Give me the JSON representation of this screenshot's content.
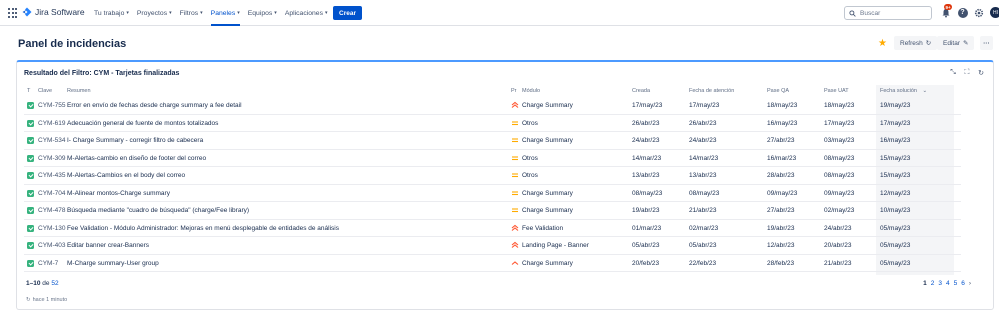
{
  "topnav": {
    "product": "Jira Software",
    "items": [
      {
        "label": "Tu trabajo",
        "active": false
      },
      {
        "label": "Proyectos",
        "active": false
      },
      {
        "label": "Filtros",
        "active": false
      },
      {
        "label": "Paneles",
        "active": true
      },
      {
        "label": "Equipos",
        "active": false
      },
      {
        "label": "Aplicaciones",
        "active": false
      }
    ],
    "create_label": "Crear",
    "search_placeholder": "Buscar",
    "notifications_badge": "9+",
    "help_glyph": "?",
    "avatar_initials": "HI"
  },
  "page": {
    "title": "Panel de incidencias",
    "refresh_label": "Refresh",
    "edit_label": "Editar",
    "more_label": "···"
  },
  "gadget": {
    "title": "Resultado del Filtro: CYM - Tarjetas finalizadas",
    "columns": {
      "t": "T",
      "key": "Clave",
      "summary": "Resumen",
      "priority": "Pr",
      "module": "Módulo",
      "created": "Creada",
      "attention": "Fecha de atención",
      "qa": "Pase QA",
      "uat": "Pase UAT",
      "solution": "Fecha solución"
    },
    "sort_indicator": "⌄",
    "rows": [
      {
        "key": "CYM-755",
        "summary": "Error en envío de fechas desde charge summary a fee detail",
        "priority": "highest",
        "module": "Charge Summary",
        "created": "17/may/23",
        "attention": "17/may/23",
        "qa": "18/may/23",
        "uat": "18/may/23",
        "solution": "19/may/23"
      },
      {
        "key": "CYM-619",
        "summary": "Adecuación general de fuente de montos totalizados",
        "priority": "medium",
        "module": "Otros",
        "created": "26/abr/23",
        "attention": "26/abr/23",
        "qa": "16/may/23",
        "uat": "17/may/23",
        "solution": "17/may/23"
      },
      {
        "key": "CYM-534",
        "summary": "I- Charge Summary - corregir filtro de cabecera",
        "priority": "medium",
        "module": "Charge Summary",
        "created": "24/abr/23",
        "attention": "24/abr/23",
        "qa": "27/abr/23",
        "uat": "03/may/23",
        "solution": "16/may/23"
      },
      {
        "key": "CYM-309",
        "summary": "M-Alertas-cambio en diseño de footer del correo",
        "priority": "medium",
        "module": "Otros",
        "created": "14/mar/23",
        "attention": "14/mar/23",
        "qa": "16/mar/23",
        "uat": "08/may/23",
        "solution": "15/may/23"
      },
      {
        "key": "CYM-435",
        "summary": "M-Alertas-Cambios en el body del correo",
        "priority": "medium",
        "module": "Otros",
        "created": "13/abr/23",
        "attention": "13/abr/23",
        "qa": "28/abr/23",
        "uat": "08/may/23",
        "solution": "15/may/23"
      },
      {
        "key": "CYM-704",
        "summary": "M-Alinear montos-Charge summary",
        "priority": "medium",
        "module": "Charge Summary",
        "created": "08/may/23",
        "attention": "08/may/23",
        "qa": "09/may/23",
        "uat": "09/may/23",
        "solution": "12/may/23"
      },
      {
        "key": "CYM-478",
        "summary": "Búsqueda mediante \"cuadro de búsqueda\" (charge/Fee library)",
        "priority": "medium",
        "module": "Charge Summary",
        "created": "19/abr/23",
        "attention": "21/abr/23",
        "qa": "27/abr/23",
        "uat": "02/may/23",
        "solution": "10/may/23"
      },
      {
        "key": "CYM-130",
        "summary": "Fee Validation - Módulo Administrador: Mejoras en menú desplegable de entidades de análisis",
        "priority": "highest",
        "module": "Fee Validation",
        "created": "01/mar/23",
        "attention": "02/mar/23",
        "qa": "19/abr/23",
        "uat": "24/abr/23",
        "solution": "05/may/23"
      },
      {
        "key": "CYM-403",
        "summary": "Editar banner crear-Banners",
        "priority": "highest",
        "module": "Landing Page - Banner",
        "created": "05/abr/23",
        "attention": "05/abr/23",
        "qa": "12/abr/23",
        "uat": "20/abr/23",
        "solution": "05/may/23"
      },
      {
        "key": "CYM-7",
        "summary": "M-Charge summary-User group",
        "priority": "high",
        "module": "Charge Summary",
        "created": "20/feb/23",
        "attention": "22/feb/23",
        "qa": "28/feb/23",
        "uat": "21/abr/23",
        "solution": "05/may/23"
      }
    ],
    "footer": {
      "range": "1–10",
      "of": "de",
      "total": "52",
      "updated": "hace 1 minuto"
    },
    "pager": {
      "current": "1",
      "pages": [
        "2",
        "3",
        "4",
        "5",
        "6"
      ],
      "next": "›"
    }
  },
  "colors": {
    "primary": "#0052cc",
    "story_green": "#36b37e",
    "priority_high": "#ff5630",
    "priority_medium": "#ffab00",
    "star": "#ffab00"
  }
}
